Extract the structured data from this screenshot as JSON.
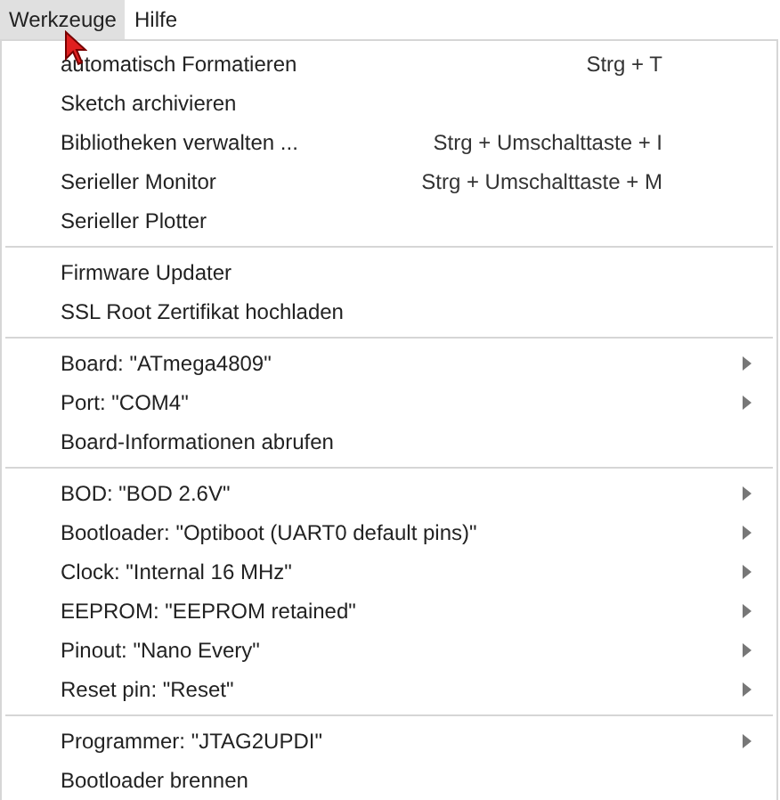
{
  "menubar": [
    {
      "label": "Werkzeuge",
      "selected": true
    },
    {
      "label": "Hilfe",
      "selected": false
    }
  ],
  "menu": {
    "groups": [
      {
        "items": [
          {
            "label": "automatisch Formatieren",
            "shortcut": "Strg + T",
            "submenu": false
          },
          {
            "label": "Sketch archivieren",
            "submenu": false
          },
          {
            "label": "Bibliotheken verwalten ...",
            "shortcut": "Strg + Umschalttaste + I",
            "submenu": false
          },
          {
            "label": "Serieller Monitor",
            "shortcut": "Strg + Umschalttaste + M",
            "submenu": false
          },
          {
            "label": "Serieller Plotter",
            "submenu": false
          }
        ]
      },
      {
        "items": [
          {
            "label": "Firmware Updater",
            "submenu": false
          },
          {
            "label": "SSL Root Zertifikat hochladen",
            "submenu": false
          }
        ]
      },
      {
        "items": [
          {
            "label": "Board: \"ATmega4809\"",
            "submenu": true
          },
          {
            "label": "Port: \"COM4\"",
            "submenu": true
          },
          {
            "label": "Board-Informationen abrufen",
            "submenu": false
          }
        ]
      },
      {
        "items": [
          {
            "label": "BOD: \"BOD 2.6V\"",
            "submenu": true
          },
          {
            "label": "Bootloader: \"Optiboot (UART0 default pins)\"",
            "submenu": true
          },
          {
            "label": "Clock: \"Internal 16 MHz\"",
            "submenu": true
          },
          {
            "label": "EEPROM: \"EEPROM retained\"",
            "submenu": true
          },
          {
            "label": "Pinout: \"Nano Every\"",
            "submenu": true
          },
          {
            "label": "Reset pin: \"Reset\"",
            "submenu": true
          }
        ]
      },
      {
        "items": [
          {
            "label": "Programmer: \"JTAG2UPDI\"",
            "submenu": true
          },
          {
            "label": "Bootloader brennen",
            "submenu": false
          }
        ]
      }
    ]
  }
}
